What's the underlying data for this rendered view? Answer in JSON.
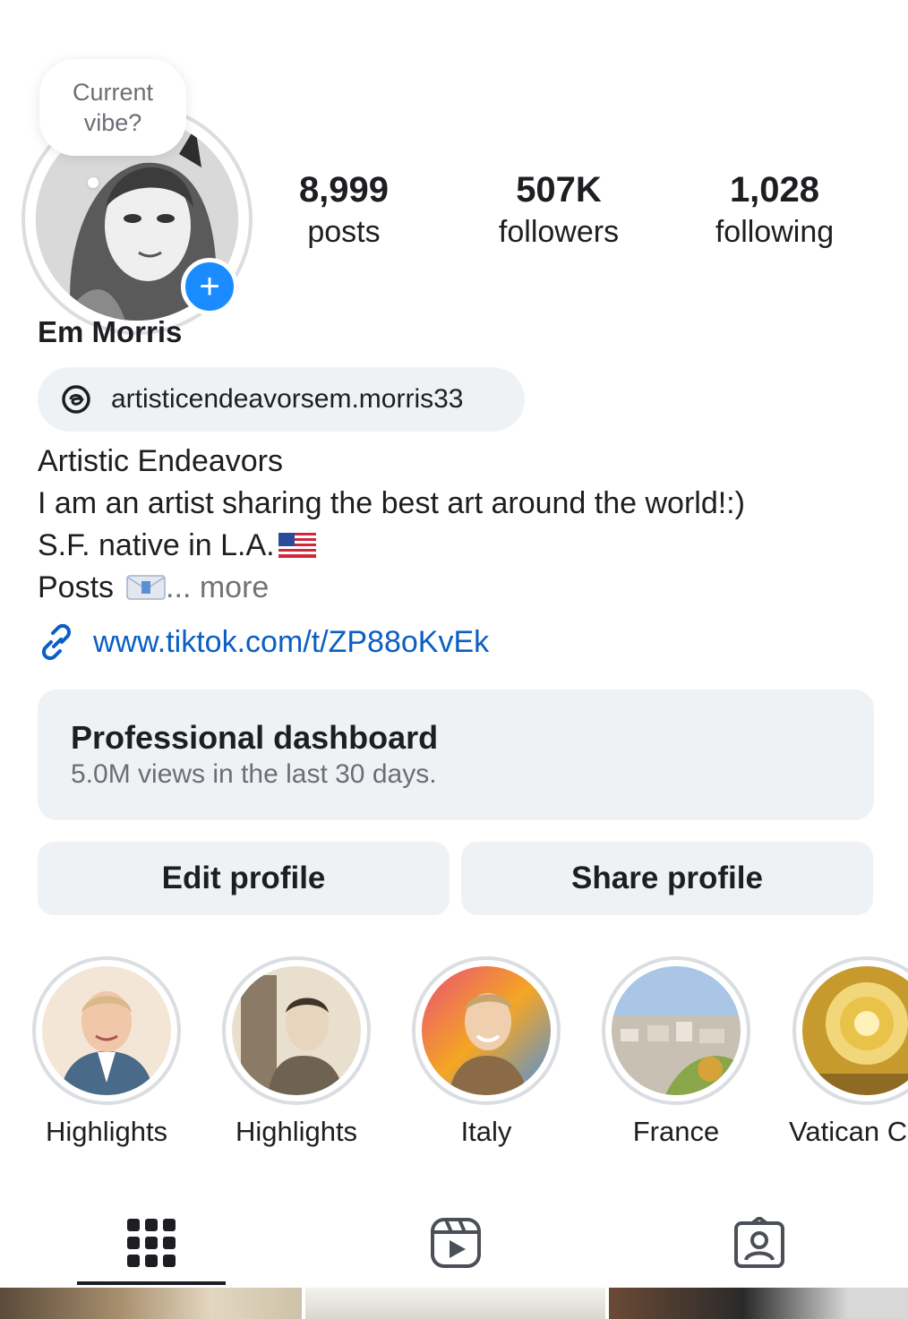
{
  "note": {
    "text_line1": "Current",
    "text_line2": "vibe?"
  },
  "profile": {
    "name": "Em Morris",
    "threads_handle": "artisticendeavorsem.morris33",
    "add_story_symbol": "+"
  },
  "stats": [
    {
      "value": "8,999",
      "label": "posts"
    },
    {
      "value": "507K",
      "label": "followers"
    },
    {
      "value": "1,028",
      "label": "following"
    }
  ],
  "bio": {
    "line1": "Artistic Endeavors",
    "line2": "I am an artist sharing the best art around the world!:)",
    "line3": "S.F. native in L.A.",
    "line4": "Posts",
    "more": "... more"
  },
  "link": {
    "url": "www.tiktok.com/t/ZP88oKvEk"
  },
  "dashboard": {
    "title": "Professional dashboard",
    "subtitle": "5.0M views in the last 30 days."
  },
  "buttons": {
    "edit": "Edit profile",
    "share": "Share profile"
  },
  "highlights": [
    {
      "label": "Highlights"
    },
    {
      "label": "Highlights"
    },
    {
      "label": "Italy"
    },
    {
      "label": "France"
    },
    {
      "label": "Vatican C"
    }
  ],
  "tabs": [
    {
      "icon": "grid-icon",
      "active": true
    },
    {
      "icon": "reels-icon",
      "active": false
    },
    {
      "icon": "tagged-icon",
      "active": false
    }
  ],
  "colors": {
    "accent_blue": "#1a8cff",
    "link_blue": "#0a5fc4",
    "button_bg": "#eff2f5"
  }
}
